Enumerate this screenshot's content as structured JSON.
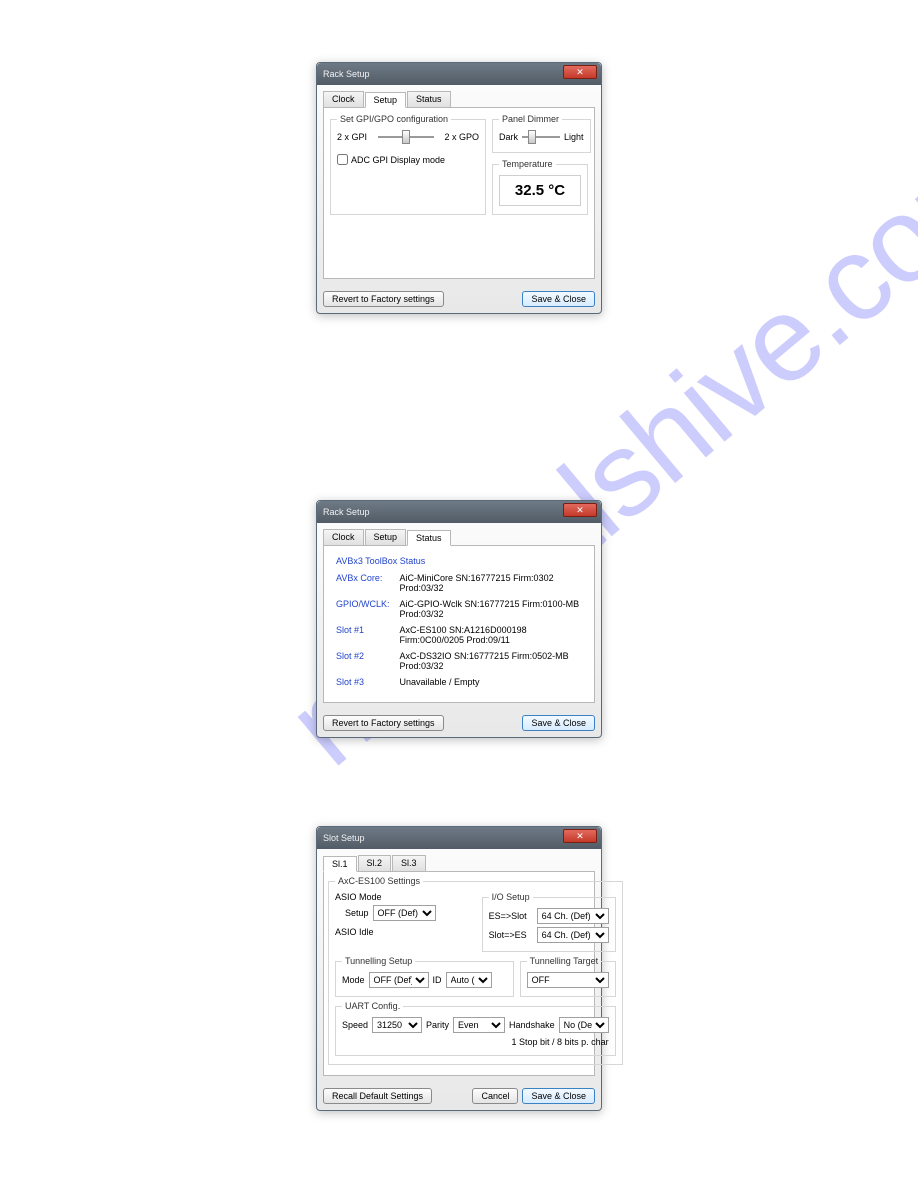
{
  "watermark": "manualshive.com",
  "dialog1": {
    "title": "Rack Setup",
    "tabs": [
      "Clock",
      "Setup",
      "Status"
    ],
    "activeTab": 1,
    "gpi_legend": "Set GPI/GPO configuration",
    "gpi_left": "2 x GPI",
    "gpi_right": "2 x GPO",
    "adc_label": "ADC GPI Display mode",
    "dimmer_legend": "Panel Dimmer",
    "dimmer_left": "Dark",
    "dimmer_right": "Light",
    "temp_label": "Temperature",
    "temp_value": "32.5 °C",
    "revert": "Revert to Factory settings",
    "save": "Save & Close"
  },
  "dialog2": {
    "title": "Rack Setup",
    "tabs": [
      "Clock",
      "Setup",
      "Status"
    ],
    "activeTab": 2,
    "head": "AVBx3 ToolBox Status",
    "rows": [
      {
        "lbl": "AVBx Core:",
        "val": "AiC-MiniCore SN:16777215 Firm:0302 Prod:03/32"
      },
      {
        "lbl": "GPIO/WCLK:",
        "val": "AiC-GPIO-Wclk SN:16777215 Firm:0100-MB Prod:03/32"
      },
      {
        "lbl": "Slot #1",
        "val": "AxC-ES100 SN:A1216D000198 Firm:0C00/0205 Prod:09/11"
      },
      {
        "lbl": "Slot #2",
        "val": "AxC-DS32IO SN:16777215 Firm:0502-MB Prod:03/32"
      },
      {
        "lbl": "Slot #3",
        "val": "Unavailable / Empty"
      }
    ],
    "revert": "Revert to Factory settings",
    "save": "Save & Close"
  },
  "dialog3": {
    "title": "Slot Setup",
    "tabs": [
      "Sl.1",
      "Sl.2",
      "Sl.3"
    ],
    "activeTab": 0,
    "settings_legend": "AxC-ES100 Settings",
    "asio_mode": "ASIO Mode",
    "setup_label": "Setup",
    "setup_value": "OFF (Def)",
    "asio_idle": "ASIO Idle",
    "io_legend": "I/O Setup",
    "es_slot": "ES=>Slot",
    "es_slot_value": "64 Ch. (Def)",
    "slot_es": "Slot=>ES",
    "slot_es_value": "64 Ch. (Def)",
    "tun_setup_legend": "Tunnelling Setup",
    "mode_label": "Mode",
    "mode_value": "OFF (Def)",
    "id_label": "ID",
    "id_value": "Auto (D",
    "tun_target_legend": "Tunnelling Target",
    "target_value": "OFF",
    "uart_legend": "UART Config.",
    "speed_label": "Speed",
    "speed_value": "31250",
    "parity_label": "Parity",
    "parity_value": "Even",
    "hand_label": "Handshake",
    "hand_value": "No (Def)",
    "uart_note": "1 Stop bit / 8 bits p. char",
    "recall": "Recall Default Settings",
    "cancel": "Cancel",
    "save": "Save & Close"
  }
}
